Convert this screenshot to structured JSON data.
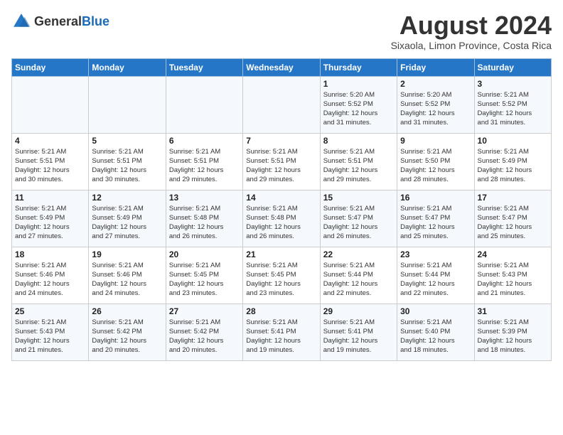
{
  "header": {
    "logo_general": "General",
    "logo_blue": "Blue",
    "month_title": "August 2024",
    "location": "Sixaola, Limon Province, Costa Rica"
  },
  "weekdays": [
    "Sunday",
    "Monday",
    "Tuesday",
    "Wednesday",
    "Thursday",
    "Friday",
    "Saturday"
  ],
  "weeks": [
    [
      {
        "day": "",
        "info": ""
      },
      {
        "day": "",
        "info": ""
      },
      {
        "day": "",
        "info": ""
      },
      {
        "day": "",
        "info": ""
      },
      {
        "day": "1",
        "info": "Sunrise: 5:20 AM\nSunset: 5:52 PM\nDaylight: 12 hours\nand 31 minutes."
      },
      {
        "day": "2",
        "info": "Sunrise: 5:20 AM\nSunset: 5:52 PM\nDaylight: 12 hours\nand 31 minutes."
      },
      {
        "day": "3",
        "info": "Sunrise: 5:21 AM\nSunset: 5:52 PM\nDaylight: 12 hours\nand 31 minutes."
      }
    ],
    [
      {
        "day": "4",
        "info": "Sunrise: 5:21 AM\nSunset: 5:51 PM\nDaylight: 12 hours\nand 30 minutes."
      },
      {
        "day": "5",
        "info": "Sunrise: 5:21 AM\nSunset: 5:51 PM\nDaylight: 12 hours\nand 30 minutes."
      },
      {
        "day": "6",
        "info": "Sunrise: 5:21 AM\nSunset: 5:51 PM\nDaylight: 12 hours\nand 29 minutes."
      },
      {
        "day": "7",
        "info": "Sunrise: 5:21 AM\nSunset: 5:51 PM\nDaylight: 12 hours\nand 29 minutes."
      },
      {
        "day": "8",
        "info": "Sunrise: 5:21 AM\nSunset: 5:51 PM\nDaylight: 12 hours\nand 29 minutes."
      },
      {
        "day": "9",
        "info": "Sunrise: 5:21 AM\nSunset: 5:50 PM\nDaylight: 12 hours\nand 28 minutes."
      },
      {
        "day": "10",
        "info": "Sunrise: 5:21 AM\nSunset: 5:49 PM\nDaylight: 12 hours\nand 28 minutes."
      }
    ],
    [
      {
        "day": "11",
        "info": "Sunrise: 5:21 AM\nSunset: 5:49 PM\nDaylight: 12 hours\nand 27 minutes."
      },
      {
        "day": "12",
        "info": "Sunrise: 5:21 AM\nSunset: 5:49 PM\nDaylight: 12 hours\nand 27 minutes."
      },
      {
        "day": "13",
        "info": "Sunrise: 5:21 AM\nSunset: 5:48 PM\nDaylight: 12 hours\nand 26 minutes."
      },
      {
        "day": "14",
        "info": "Sunrise: 5:21 AM\nSunset: 5:48 PM\nDaylight: 12 hours\nand 26 minutes."
      },
      {
        "day": "15",
        "info": "Sunrise: 5:21 AM\nSunset: 5:47 PM\nDaylight: 12 hours\nand 26 minutes."
      },
      {
        "day": "16",
        "info": "Sunrise: 5:21 AM\nSunset: 5:47 PM\nDaylight: 12 hours\nand 25 minutes."
      },
      {
        "day": "17",
        "info": "Sunrise: 5:21 AM\nSunset: 5:47 PM\nDaylight: 12 hours\nand 25 minutes."
      }
    ],
    [
      {
        "day": "18",
        "info": "Sunrise: 5:21 AM\nSunset: 5:46 PM\nDaylight: 12 hours\nand 24 minutes."
      },
      {
        "day": "19",
        "info": "Sunrise: 5:21 AM\nSunset: 5:46 PM\nDaylight: 12 hours\nand 24 minutes."
      },
      {
        "day": "20",
        "info": "Sunrise: 5:21 AM\nSunset: 5:45 PM\nDaylight: 12 hours\nand 23 minutes."
      },
      {
        "day": "21",
        "info": "Sunrise: 5:21 AM\nSunset: 5:45 PM\nDaylight: 12 hours\nand 23 minutes."
      },
      {
        "day": "22",
        "info": "Sunrise: 5:21 AM\nSunset: 5:44 PM\nDaylight: 12 hours\nand 22 minutes."
      },
      {
        "day": "23",
        "info": "Sunrise: 5:21 AM\nSunset: 5:44 PM\nDaylight: 12 hours\nand 22 minutes."
      },
      {
        "day": "24",
        "info": "Sunrise: 5:21 AM\nSunset: 5:43 PM\nDaylight: 12 hours\nand 21 minutes."
      }
    ],
    [
      {
        "day": "25",
        "info": "Sunrise: 5:21 AM\nSunset: 5:43 PM\nDaylight: 12 hours\nand 21 minutes."
      },
      {
        "day": "26",
        "info": "Sunrise: 5:21 AM\nSunset: 5:42 PM\nDaylight: 12 hours\nand 20 minutes."
      },
      {
        "day": "27",
        "info": "Sunrise: 5:21 AM\nSunset: 5:42 PM\nDaylight: 12 hours\nand 20 minutes."
      },
      {
        "day": "28",
        "info": "Sunrise: 5:21 AM\nSunset: 5:41 PM\nDaylight: 12 hours\nand 19 minutes."
      },
      {
        "day": "29",
        "info": "Sunrise: 5:21 AM\nSunset: 5:41 PM\nDaylight: 12 hours\nand 19 minutes."
      },
      {
        "day": "30",
        "info": "Sunrise: 5:21 AM\nSunset: 5:40 PM\nDaylight: 12 hours\nand 18 minutes."
      },
      {
        "day": "31",
        "info": "Sunrise: 5:21 AM\nSunset: 5:39 PM\nDaylight: 12 hours\nand 18 minutes."
      }
    ]
  ]
}
